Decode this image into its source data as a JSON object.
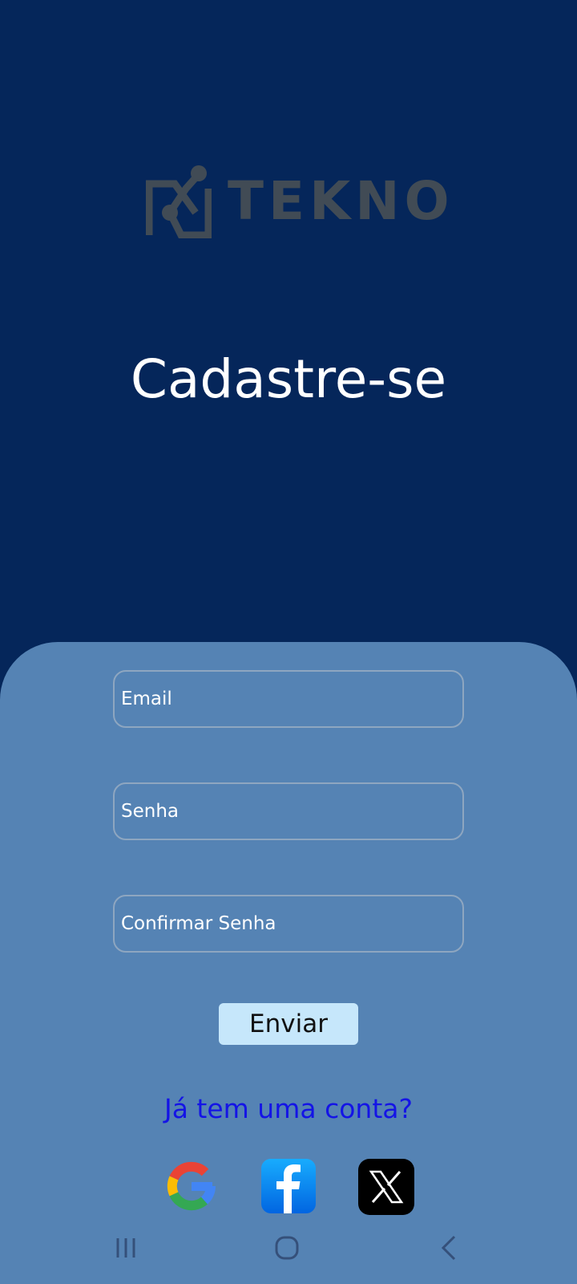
{
  "brand": {
    "name": "TEKNO"
  },
  "header": {
    "title": "Cadastre-se"
  },
  "form": {
    "email_placeholder": "Email",
    "password_placeholder": "Senha",
    "confirm_placeholder": "Confirmar Senha",
    "submit_label": "Enviar",
    "login_link": "Já tem uma conta?"
  },
  "social": [
    {
      "icon": "google-icon"
    },
    {
      "icon": "facebook-icon"
    },
    {
      "icon": "x-icon"
    }
  ],
  "nav": {
    "icons": [
      "recent-apps-icon",
      "home-icon",
      "back-icon"
    ]
  },
  "colors": {
    "background": "#05265a",
    "panel": "#5583b4",
    "button": "#c6e7fb",
    "link": "#1414e6",
    "logo": "#414b55"
  }
}
